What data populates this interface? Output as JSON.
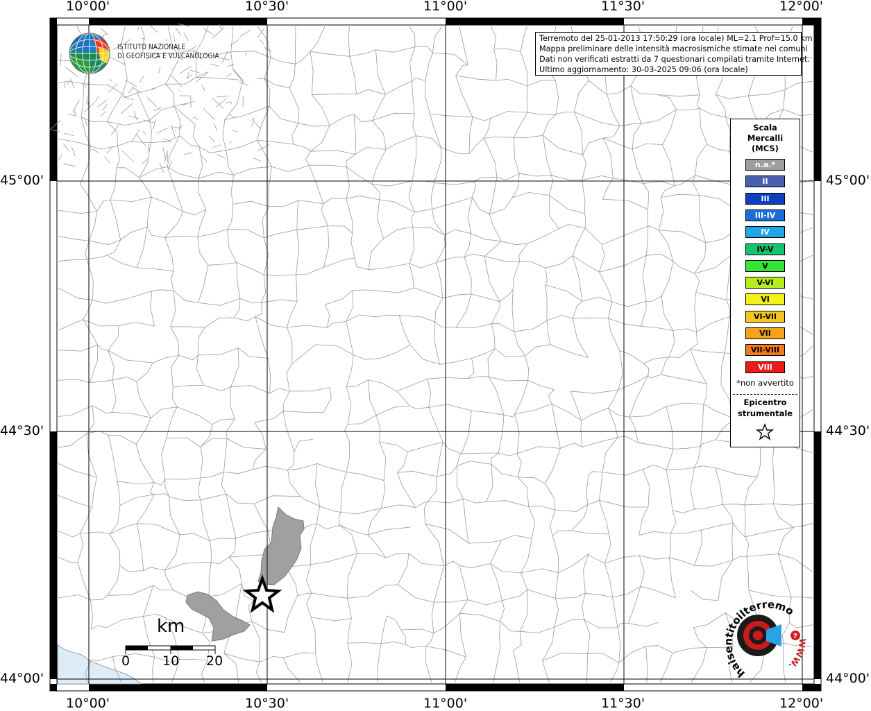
{
  "map": {
    "longitude_labels": [
      "10°00'",
      "10°30'",
      "11°00'",
      "11°30'",
      "12°00'"
    ],
    "latitude_labels": [
      "45°00'",
      "44°30'",
      "44°00'"
    ]
  },
  "logo": {
    "line1": "ISTITUTO NAZIONALE",
    "line2": "DI GEOFISICA E VULCANOLOGIA"
  },
  "info": {
    "line1": "Terremoto del 25-01-2013 17:50:29 (ora locale) ML=2.1 Prof=15.0 km",
    "line2": "Mappa preliminare delle intensità macrosismiche stimate nei comuni",
    "line3": "Dati non verificati estratti da 7 questionari compilati tramite Internet.",
    "line4": "Ultimo aggiornamento: 30-03-2025 09:06 (ora locale)"
  },
  "legend": {
    "title": [
      "Scala",
      "Mercalli",
      "(MCS)"
    ],
    "classes": [
      {
        "label": "n.a.*",
        "color": "#9e9e9e",
        "text": "#ffffff"
      },
      {
        "label": "II",
        "color": "#4a5fb0",
        "text": "#ffffff"
      },
      {
        "label": "III",
        "color": "#0d3fbf",
        "text": "#ffffff"
      },
      {
        "label": "III-IV",
        "color": "#1a6ed8",
        "text": "#ffffff"
      },
      {
        "label": "IV",
        "color": "#1ea6e6",
        "text": "#ffffff"
      },
      {
        "label": "IV-V",
        "color": "#14c46a",
        "text": "#000000"
      },
      {
        "label": "V",
        "color": "#33e633",
        "text": "#000000"
      },
      {
        "label": "V-VI",
        "color": "#b5ee1a",
        "text": "#000000"
      },
      {
        "label": "VI",
        "color": "#f2f21a",
        "text": "#000000"
      },
      {
        "label": "VI-VII",
        "color": "#f5c71a",
        "text": "#000000"
      },
      {
        "label": "VII",
        "color": "#f5a31a",
        "text": "#000000"
      },
      {
        "label": "VII-VIII",
        "color": "#f27a1a",
        "text": "#000000"
      },
      {
        "label": "VIII",
        "color": "#ee1a1a",
        "text": "#ffffff"
      }
    ],
    "note": "*non avvertito",
    "epicentre": [
      "Epicentro",
      "strumentale"
    ]
  },
  "scalebar": {
    "unit": "km",
    "ticks": [
      "0",
      "10",
      "20"
    ]
  },
  "colors": {
    "felt_area": "#a0a0a0",
    "sea": "#dcecf8",
    "boundaries": "#9a9a9a"
  },
  "site_logo": {
    "text": "haisentitoilterremoto.it",
    "url_text": "WWW."
  }
}
